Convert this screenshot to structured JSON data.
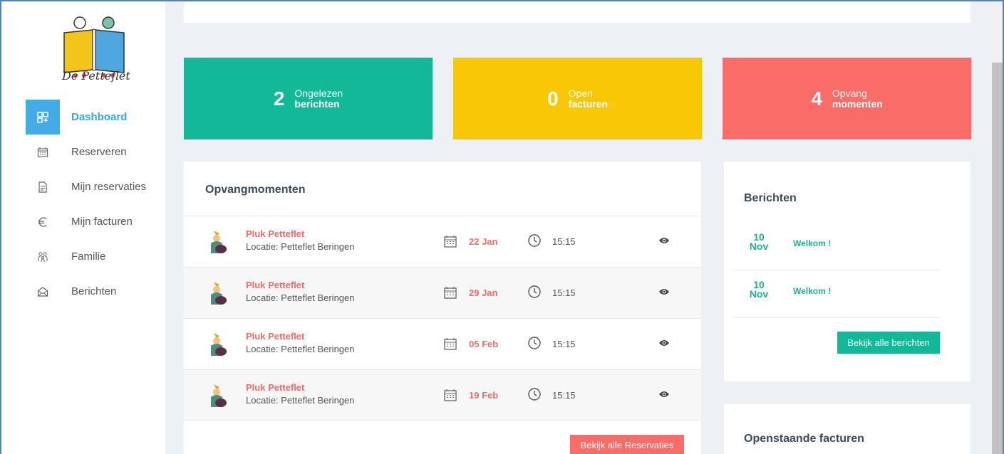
{
  "brand": {
    "name": "De Petteflet"
  },
  "sidebar": {
    "items": [
      {
        "label": "Dashboard",
        "icon": "dashboard-icon",
        "active": true
      },
      {
        "label": "Reserveren",
        "icon": "calendar-icon"
      },
      {
        "label": "Mijn reservaties",
        "icon": "document-icon"
      },
      {
        "label": "Mijn facturen",
        "icon": "euro-icon"
      },
      {
        "label": "Familie",
        "icon": "family-icon"
      },
      {
        "label": "Berichten",
        "icon": "envelope-icon"
      }
    ]
  },
  "stats": [
    {
      "value": "2",
      "line1": "Ongelezen",
      "line2": "berichten",
      "color": "#13b899"
    },
    {
      "value": "0",
      "line1": "Open",
      "line2": "facturen",
      "color": "#f8c807"
    },
    {
      "value": "4",
      "line1": "Opvang",
      "line2": "momenten",
      "color": "#fa6c67"
    }
  ],
  "opvang": {
    "title": "Opvangmomenten",
    "rows": [
      {
        "name": "Pluk Petteflet",
        "location": "Locatie: Petteflet Beringen",
        "date": "22 Jan",
        "time": "15:15"
      },
      {
        "name": "Pluk Petteflet",
        "location": "Locatie: Petteflet Beringen",
        "date": "29 Jan",
        "time": "15:15"
      },
      {
        "name": "Pluk Petteflet",
        "location": "Locatie: Petteflet Beringen",
        "date": "05 Feb",
        "time": "15:15"
      },
      {
        "name": "Pluk Petteflet",
        "location": "Locatie: Petteflet Beringen",
        "date": "19 Feb",
        "time": "15:15"
      }
    ],
    "button": "Bekijk alle Reservaties"
  },
  "berichten": {
    "title": "Berichten",
    "items": [
      {
        "day": "10",
        "month": "Nov",
        "title": "Welkom !"
      },
      {
        "day": "10",
        "month": "Nov",
        "title": "Welkom !"
      }
    ],
    "button": "Bekijk alle berichten"
  },
  "facturen": {
    "title": "Openstaande facturen"
  },
  "colors": {
    "accent": "#43ace6",
    "green": "#13b899",
    "red": "#fa6c67",
    "yellow": "#f8c807"
  }
}
